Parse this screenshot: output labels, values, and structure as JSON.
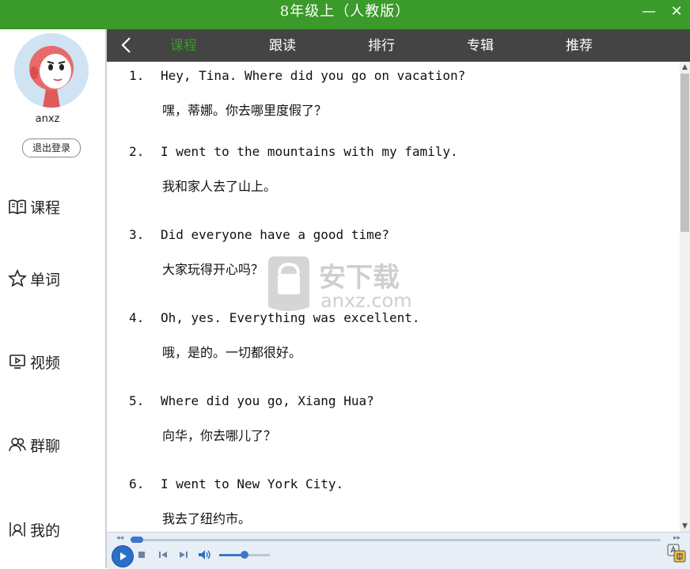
{
  "window": {
    "title": "8年级上（人教版）",
    "minimize": "—",
    "close": "✕"
  },
  "user": {
    "name": "anxz",
    "logout_label": "退出登录"
  },
  "nav": [
    {
      "label": "课程",
      "icon": "book-icon"
    },
    {
      "label": "单词",
      "icon": "star-icon"
    },
    {
      "label": "视频",
      "icon": "video-icon"
    },
    {
      "label": "群聊",
      "icon": "group-icon"
    },
    {
      "label": "我的",
      "icon": "profile-icon"
    }
  ],
  "tabs": [
    {
      "label": "课程",
      "active": true
    },
    {
      "label": "跟读"
    },
    {
      "label": "排行"
    },
    {
      "label": "专辑"
    },
    {
      "label": "推荐"
    }
  ],
  "sentences": [
    {
      "num": "1.",
      "en": "Hey, Tina. Where did you go on vacation?",
      "cn": "嘿，蒂娜。你去哪里度假了？"
    },
    {
      "num": "2.",
      "en": "I went to the mountains with my family.",
      "cn": "我和家人去了山上。"
    },
    {
      "num": "3.",
      "en": "Did everyone have a good time?",
      "cn": "大家玩得开心吗？"
    },
    {
      "num": "4.",
      "en": "Oh, yes. Everything was excellent.",
      "cn": "哦，是的。一切都很好。"
    },
    {
      "num": "5.",
      "en": "Where did you go, Xiang Hua?",
      "cn": "向华，你去哪儿了？"
    },
    {
      "num": "6.",
      "en": "I went to New York City.",
      "cn": "我去了纽约市。"
    }
  ],
  "watermark": {
    "cn": "安下载",
    "en": "anxz.com"
  },
  "player": {
    "progress": 0.0,
    "volume": 0.5
  },
  "colors": {
    "titlebar": "#3a9a2a",
    "tabbar": "#444444",
    "active_tab": "#3a9a2a",
    "accent": "#2a6fc9"
  }
}
